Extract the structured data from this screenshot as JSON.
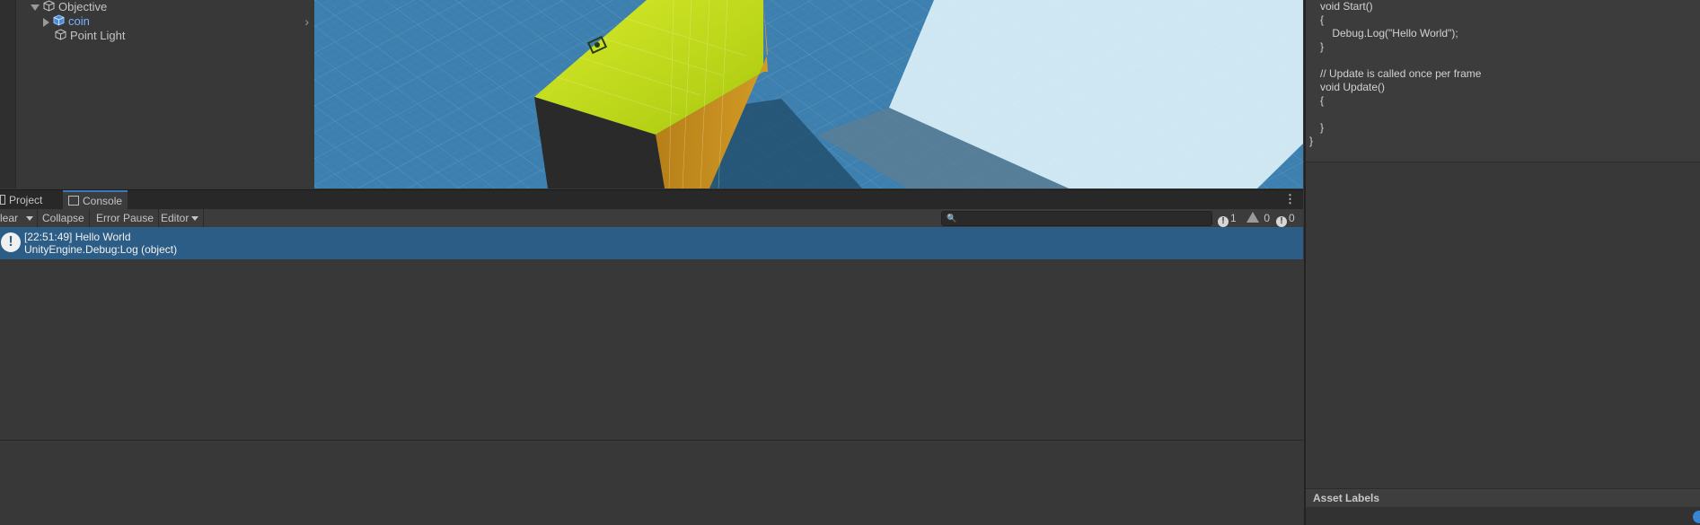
{
  "hierarchy": {
    "items": [
      {
        "label": "Objective",
        "expanded": true
      },
      {
        "label": "coin",
        "expanded": false,
        "color": "#7cb3ff"
      },
      {
        "label": "Point Light"
      }
    ]
  },
  "scene": {
    "background": "#3d7fae",
    "cube_top_color": "#c2dc1e",
    "cube_side_color": "#c08a1d"
  },
  "inspector": {
    "code_lines": [
      "void Start()",
      "{",
      "    Debug.Log(\"Hello World\");",
      "}",
      "",
      "// Update is called once per frame",
      "void Update()",
      "{",
      "",
      "}",
      "}"
    ],
    "asset_labels": "Asset Labels"
  },
  "console": {
    "tabs": [
      {
        "label": "Project",
        "icon": "folder-icon"
      },
      {
        "label": "Console",
        "icon": "console-icon",
        "active": true
      }
    ],
    "toolbar": {
      "clear": "lear",
      "collapse": "Collapse",
      "error_pause": "Error Pause",
      "editor": "Editor"
    },
    "counts": {
      "info": "1",
      "warnings": "0",
      "errors": "0"
    },
    "log": {
      "line1": "[22:51:49] Hello World",
      "line2": "UnityEngine.Debug:Log (object)"
    },
    "selection_color": "#2c5d87"
  }
}
